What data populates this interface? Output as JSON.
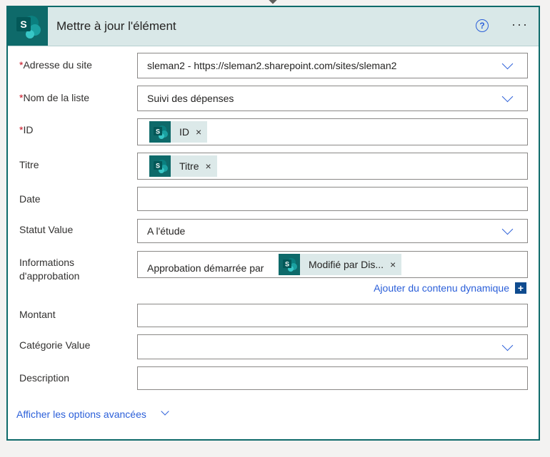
{
  "header": {
    "title": "Mettre à jour l'élément",
    "help_glyph": "?",
    "more_glyph": "···",
    "icon": "sharepoint-icon"
  },
  "fields": {
    "site": {
      "required": "*",
      "label": "Adresse du site",
      "value": "sleman2 - https://sleman2.sharepoint.com/sites/sleman2"
    },
    "list": {
      "required": "*",
      "label": "Nom de la liste",
      "value": "Suivi des dépenses"
    },
    "id": {
      "required": "*",
      "label": "ID",
      "token": "ID",
      "remove": "×"
    },
    "title": {
      "label": "Titre",
      "token": "Titre",
      "remove": "×"
    },
    "date": {
      "label": "Date",
      "value": ""
    },
    "status": {
      "label": "Statut Value",
      "value": "A l'étude"
    },
    "approval": {
      "label_line1": "Informations",
      "label_line2": "d'approbation",
      "prefix": "Approbation démarrée par",
      "token": "Modifié par Dis...",
      "remove": "×"
    },
    "amount": {
      "label": "Montant",
      "value": ""
    },
    "category": {
      "label": "Catégorie Value",
      "value": ""
    },
    "description": {
      "label": "Description",
      "value": ""
    }
  },
  "dynamic_content": {
    "label": "Ajouter du contenu dynamique",
    "plus": "+"
  },
  "advanced": {
    "label": "Afficher les options avancées"
  },
  "colors": {
    "accent": "#0e6a6a",
    "link": "#2b5fd9",
    "header_bg": "#d9e8e8",
    "required": "#c50f1f"
  }
}
